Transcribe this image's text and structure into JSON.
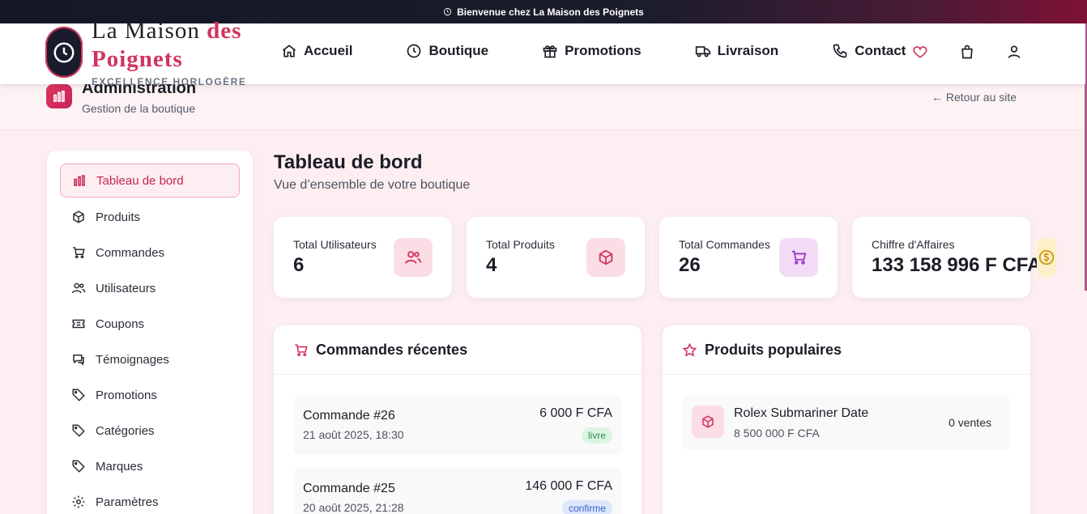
{
  "topbar": {
    "message": "Bienvenue chez La Maison des Poignets",
    "icon": "clock-icon"
  },
  "brand": {
    "line1_a": "La Maison ",
    "line1_b": "des",
    "line2": "Poignets",
    "tagline": "EXCELLENCE HORLOGÈRE"
  },
  "nav": {
    "items": [
      {
        "label": "Accueil",
        "icon": "home-icon"
      },
      {
        "label": "Boutique",
        "icon": "clock-icon"
      },
      {
        "label": "Promotions",
        "icon": "gift-icon"
      },
      {
        "label": "Livraison",
        "icon": "truck-icon"
      },
      {
        "label": "Contact",
        "icon": "phone-icon"
      }
    ]
  },
  "admin": {
    "title": "Administration",
    "subtitle": "Gestion de la boutique",
    "back": "← Retour au site"
  },
  "sidebar": {
    "items": [
      {
        "label": "Tableau de bord",
        "active": true
      },
      {
        "label": "Produits"
      },
      {
        "label": "Commandes"
      },
      {
        "label": "Utilisateurs"
      },
      {
        "label": "Coupons"
      },
      {
        "label": "Témoignages"
      },
      {
        "label": "Promotions"
      },
      {
        "label": "Catégories"
      },
      {
        "label": "Marques"
      },
      {
        "label": "Paramètres"
      }
    ]
  },
  "dashboard": {
    "title": "Tableau de bord",
    "subtitle": "Vue d’ensemble de votre boutique"
  },
  "stats": [
    {
      "label": "Total Utilisateurs",
      "value": "6"
    },
    {
      "label": "Total Produits",
      "value": "4"
    },
    {
      "label": "Total Commandes",
      "value": "26"
    },
    {
      "label": "Chiffre d'Affaires",
      "value": "133 158 996 F CFA"
    }
  ],
  "recent_orders": {
    "title": "Commandes récentes",
    "orders": [
      {
        "title": "Commande #26",
        "date": "21 août 2025, 18:30",
        "amount": "6 000 F CFA",
        "status": "livre"
      },
      {
        "title": "Commande #25",
        "date": "20 août 2025, 21:28",
        "amount": "146 000 F CFA",
        "status": "confirme"
      }
    ]
  },
  "popular_products": {
    "title": "Produits populaires",
    "products": [
      {
        "name": "Rolex Submariner Date",
        "price": "8 500 000 F CFA",
        "sales": "0 ventes"
      }
    ]
  },
  "colors": {
    "accent": "#d2335c",
    "delivered_bg": "#dcf5e3",
    "delivered_text": "#2e8b4e",
    "confirmed_bg": "#dde7fb",
    "confirmed_text": "#3a63c8"
  }
}
